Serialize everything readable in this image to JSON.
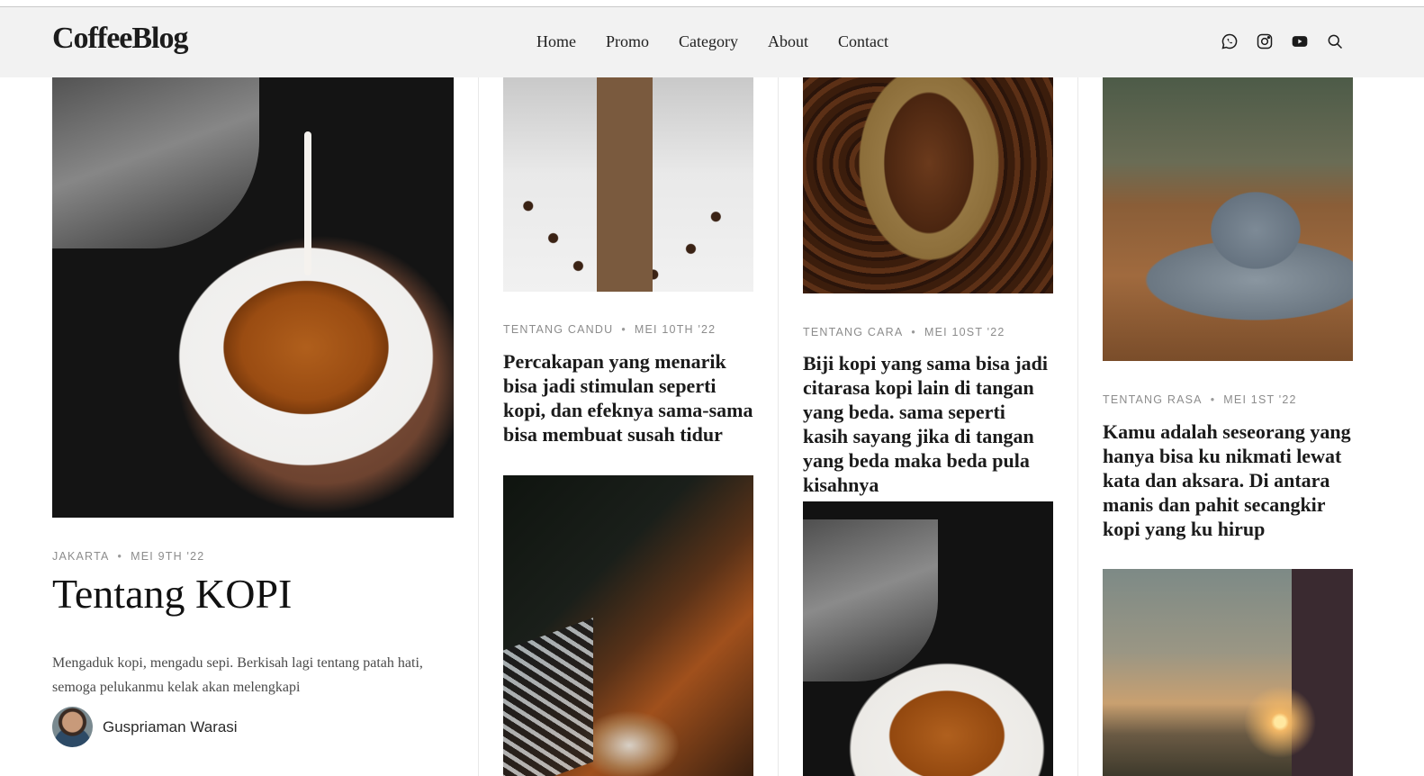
{
  "header": {
    "logo": "CoffeeBlog",
    "nav": [
      "Home",
      "Promo",
      "Category",
      "About",
      "Contact"
    ],
    "social_icons": [
      "whatsapp-icon",
      "instagram-icon",
      "youtube-icon",
      "search-icon"
    ]
  },
  "hero": {
    "location": "JAKARTA",
    "date": "MEI 9TH '22",
    "title": "Tentang KOPI",
    "excerpt": "Mengaduk kopi, mengadu sepi. Berkisah lagi tentang patah hati, semoga pelukanmu kelak akan melengkapi",
    "author": "Guspriaman Warasi"
  },
  "posts": [
    {
      "category": "TENTANG CANDU",
      "date": "MEI 10TH '22",
      "title": "Percakapan yang menarik bisa jadi stimulan seperti kopi, dan efeknya sama-sama bisa membuat susah tidur"
    },
    {
      "category": "TENTANG CARA",
      "date": "MEI 10ST '22",
      "title": "Biji kopi yang sama bisa jadi citarasa kopi lain di tangan yang beda. sama seperti kasih sayang jika di tangan yang beda maka beda pula kisahnya"
    },
    {
      "category": "TENTANG RASA",
      "date": "MEI 1ST '22",
      "title": "Kamu adalah seseorang yang hanya bisa ku nikmati lewat kata dan aksara. Di antara manis dan pahit secangkir kopi yang ku hirup"
    }
  ],
  "separator": "•"
}
